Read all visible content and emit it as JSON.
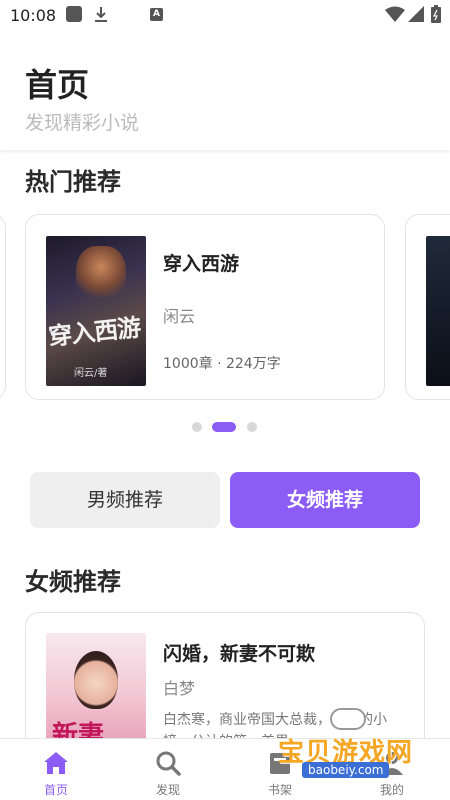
{
  "status_bar": {
    "time": "10:08",
    "a_label": "A"
  },
  "header": {
    "title": "首页",
    "subtitle": "发现精彩小说"
  },
  "hot": {
    "section_title": "热门推荐",
    "featured": {
      "title": "穿入西游",
      "author": "闲云",
      "meta": "1000章 · 224万字",
      "cover_art_title": "穿入西游",
      "cover_author": "闲云/著"
    },
    "pager": {
      "count": 3,
      "active_index": 1
    }
  },
  "tabs": {
    "male": "男频推荐",
    "female": "女频推荐",
    "active": "female"
  },
  "female": {
    "section_title": "女频推荐",
    "books": [
      {
        "title": "闪婚，新妻不可欺",
        "author": "白梦",
        "description": "白杰寒，商业帝国大总裁，年轻的小榜，公认的第一美男",
        "cover_art_title": "新妻"
      }
    ]
  },
  "bottom_nav": [
    {
      "label": "首页",
      "icon": "home-icon",
      "active": true
    },
    {
      "label": "发现",
      "icon": "search-icon",
      "active": false
    },
    {
      "label": "书架",
      "icon": "bookshelf-icon",
      "active": false
    },
    {
      "label": "我的",
      "icon": "profile-icon",
      "active": false
    }
  ],
  "watermark": {
    "text": "宝贝游戏网",
    "url": "baobeiy.com"
  },
  "colors": {
    "accent": "#8b5cf6",
    "tab_inactive_bg": "#efefef",
    "muted_text": "#888888"
  }
}
